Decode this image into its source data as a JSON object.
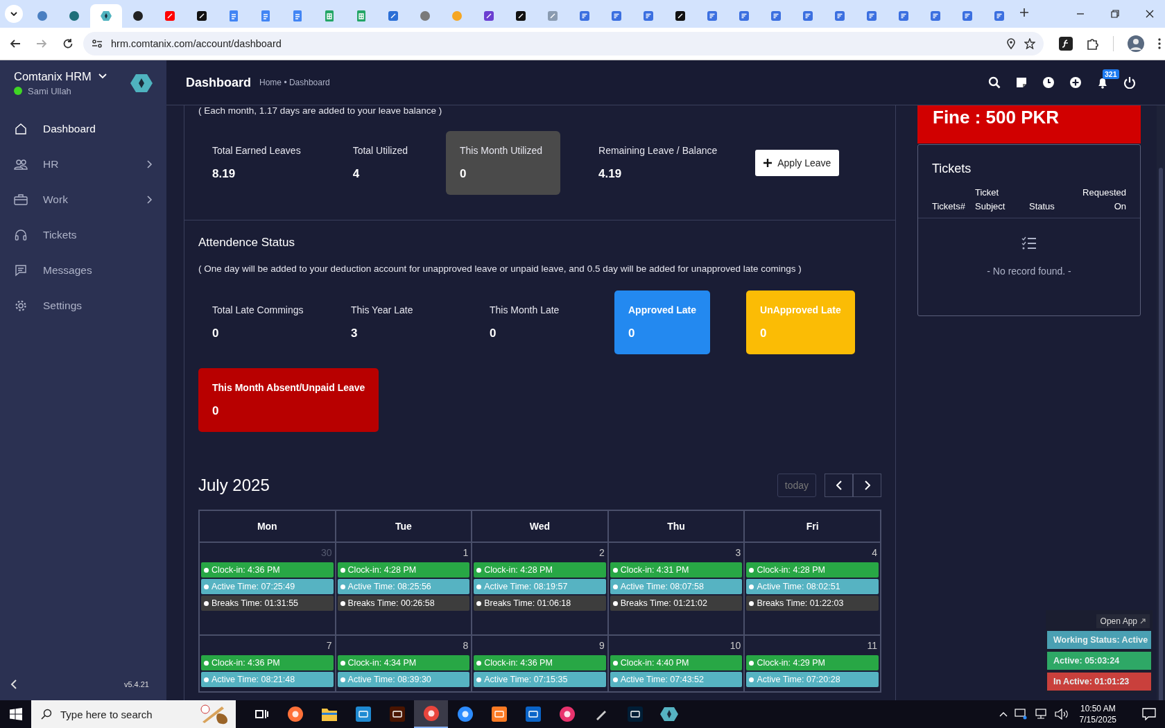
{
  "browser": {
    "tabs": [
      {
        "kind": "circle",
        "color": "#4a7fc1",
        "selected": false
      },
      {
        "kind": "circle",
        "color": "#1e6f7a",
        "selected": false
      },
      {
        "kind": "hex",
        "color": "#4fb3bf",
        "selected": true
      },
      {
        "kind": "circle",
        "color": "#222222",
        "selected": false
      },
      {
        "kind": "square",
        "color": "#ff0000",
        "selected": false
      },
      {
        "kind": "square",
        "color": "#111111",
        "selected": false
      },
      {
        "kind": "doc",
        "color": "#4285f4",
        "selected": false
      },
      {
        "kind": "doc",
        "color": "#4285f4",
        "selected": false
      },
      {
        "kind": "doc",
        "color": "#4285f4",
        "selected": false
      },
      {
        "kind": "sheet",
        "color": "#23a566",
        "selected": false
      },
      {
        "kind": "sheet",
        "color": "#23a566",
        "selected": false
      },
      {
        "kind": "square",
        "color": "#2b6fd6",
        "selected": false
      },
      {
        "kind": "circle",
        "color": "#7a7a7a",
        "selected": false
      },
      {
        "kind": "circle",
        "color": "#f5a623",
        "selected": false
      },
      {
        "kind": "square",
        "color": "#6b3fd1",
        "selected": false
      },
      {
        "kind": "square",
        "color": "#111111",
        "selected": false
      },
      {
        "kind": "square",
        "color": "#8a9bb0",
        "selected": false
      },
      {
        "kind": "form",
        "color": "#3b6fe0",
        "selected": false
      },
      {
        "kind": "form",
        "color": "#3b6fe0",
        "selected": false
      },
      {
        "kind": "form",
        "color": "#3b6fe0",
        "selected": false
      },
      {
        "kind": "square",
        "color": "#111111",
        "selected": false
      },
      {
        "kind": "form",
        "color": "#3b6fe0",
        "selected": false
      },
      {
        "kind": "form",
        "color": "#3b6fe0",
        "selected": false
      },
      {
        "kind": "form",
        "color": "#3b6fe0",
        "selected": false
      },
      {
        "kind": "form",
        "color": "#3b6fe0",
        "selected": false
      },
      {
        "kind": "form",
        "color": "#3b6fe0",
        "selected": false
      },
      {
        "kind": "form",
        "color": "#3b6fe0",
        "selected": false
      },
      {
        "kind": "form",
        "color": "#3b6fe0",
        "selected": false
      },
      {
        "kind": "form",
        "color": "#3b6fe0",
        "selected": false
      },
      {
        "kind": "form",
        "color": "#3b6fe0",
        "selected": false
      },
      {
        "kind": "form",
        "color": "#3b6fe0",
        "selected": false
      }
    ],
    "url": "hrm.comtanix.com/account/dashboard"
  },
  "sidebar": {
    "brand": "Comtanix HRM",
    "user": {
      "name": "Sami Ullah",
      "online": true
    },
    "items": [
      {
        "label": "Dashboard",
        "kind": "home",
        "selected": true,
        "expandable": false
      },
      {
        "label": "HR",
        "kind": "people",
        "selected": false,
        "expandable": true
      },
      {
        "label": "Work",
        "kind": "briefcase",
        "selected": false,
        "expandable": true
      },
      {
        "label": "Tickets",
        "kind": "headset",
        "selected": false,
        "expandable": false
      },
      {
        "label": "Messages",
        "kind": "chat",
        "selected": false,
        "expandable": false
      },
      {
        "label": "Settings",
        "kind": "gear",
        "selected": false,
        "expandable": false
      }
    ],
    "version": "v5.4.21"
  },
  "header": {
    "title": "Dashboard",
    "breadcrumb": "Home • Dashboard",
    "notification_count": "321"
  },
  "leave": {
    "note": "( Each month, 1.17 days are added to your leave balance )",
    "stats": [
      {
        "label": "Total Earned Leaves",
        "value": "8.19",
        "highlighted": false
      },
      {
        "label": "Total Utilized",
        "value": "4",
        "highlighted": false
      },
      {
        "label": "This Month Utilized",
        "value": "0",
        "highlighted": true
      },
      {
        "label": "Remaining Leave / Balance",
        "value": "4.19",
        "highlighted": false
      }
    ],
    "apply_button": "Apply Leave"
  },
  "attendance": {
    "title": "Attendence Status",
    "note": "( One day will be added to your deduction account for unapproved leave or unpaid leave, and 0.5 day will be added for unapproved late comings )",
    "stats": [
      {
        "label": "Total Late Commings",
        "value": "0"
      },
      {
        "label": "This Year Late",
        "value": "3"
      },
      {
        "label": "This Month Late",
        "value": "0"
      },
      {
        "label": "Approved Late",
        "value": "0",
        "color": "#2389f0"
      },
      {
        "label": "UnApproved Late",
        "value": "0",
        "color": "#fbbc05"
      },
      {
        "label": "This Month Absent/Unpaid Leave",
        "value": "0",
        "color": "#b80000"
      }
    ]
  },
  "calendar": {
    "title": "July 2025",
    "today": {
      "label": "today",
      "disabled": true
    },
    "days": [
      "Mon",
      "Tue",
      "Wed",
      "Thu",
      "Fri"
    ],
    "weeks": [
      [
        {
          "date": "30",
          "other_month": true,
          "events": [
            {
              "kind": "clock-in",
              "text": "Clock-in: 4:36 PM"
            },
            {
              "kind": "active",
              "text": "Active Time: 07:25:49"
            },
            {
              "kind": "breaks",
              "text": "Breaks Time: 01:31:55"
            }
          ]
        },
        {
          "date": "1",
          "other_month": false,
          "events": [
            {
              "kind": "clock-in",
              "text": "Clock-in: 4:28 PM"
            },
            {
              "kind": "active",
              "text": "Active Time: 08:25:56"
            },
            {
              "kind": "breaks",
              "text": "Breaks Time: 00:26:58"
            }
          ]
        },
        {
          "date": "2",
          "other_month": false,
          "events": [
            {
              "kind": "clock-in",
              "text": "Clock-in: 4:28 PM"
            },
            {
              "kind": "active",
              "text": "Active Time: 08:19:57"
            },
            {
              "kind": "breaks",
              "text": "Breaks Time: 01:06:18"
            }
          ]
        },
        {
          "date": "3",
          "other_month": false,
          "events": [
            {
              "kind": "clock-in",
              "text": "Clock-in: 4:31 PM"
            },
            {
              "kind": "active",
              "text": "Active Time: 08:07:58"
            },
            {
              "kind": "breaks",
              "text": "Breaks Time: 01:21:02"
            }
          ]
        },
        {
          "date": "4",
          "other_month": false,
          "events": [
            {
              "kind": "clock-in",
              "text": "Clock-in: 4:28 PM"
            },
            {
              "kind": "active",
              "text": "Active Time: 08:02:51"
            },
            {
              "kind": "breaks",
              "text": "Breaks Time: 01:22:03"
            }
          ]
        }
      ],
      [
        {
          "date": "7",
          "other_month": false,
          "events": [
            {
              "kind": "clock-in",
              "text": "Clock-in: 4:36 PM"
            },
            {
              "kind": "active",
              "text": "Active Time: 08:21:48"
            }
          ]
        },
        {
          "date": "8",
          "other_month": false,
          "events": [
            {
              "kind": "clock-in",
              "text": "Clock-in: 4:34 PM"
            },
            {
              "kind": "active",
              "text": "Active Time: 08:39:30"
            }
          ]
        },
        {
          "date": "9",
          "other_month": false,
          "events": [
            {
              "kind": "clock-in",
              "text": "Clock-in: 4:36 PM"
            },
            {
              "kind": "active",
              "text": "Active Time: 07:15:35"
            }
          ]
        },
        {
          "date": "10",
          "other_month": false,
          "events": [
            {
              "kind": "clock-in",
              "text": "Clock-in: 4:40 PM"
            },
            {
              "kind": "active",
              "text": "Active Time: 07:43:52"
            }
          ]
        },
        {
          "date": "11",
          "other_month": false,
          "events": [
            {
              "kind": "clock-in",
              "text": "Clock-in: 4:29 PM"
            },
            {
              "kind": "active",
              "text": "Active Time: 07:20:28"
            }
          ]
        }
      ]
    ]
  },
  "fine": "Fine : 500 PKR",
  "tickets": {
    "title": "Tickets",
    "columns": [
      "Tickets#",
      "Ticket Subject",
      "Status",
      "Requested On"
    ],
    "empty_text": "- No record found. -"
  },
  "widget": {
    "open_app": "Open App",
    "rows": [
      {
        "text": "Working Status: Active",
        "color": "#4aa0b3"
      },
      {
        "text": "Active: 05:03:24",
        "color": "#2ea866"
      },
      {
        "text": "In Active: 01:01:23",
        "color": "#c9403c"
      }
    ]
  },
  "taskbar": {
    "search_placeholder": "Type here to search",
    "apps": [
      {
        "kind": "taskview",
        "color": "#ffffff",
        "selected": false
      },
      {
        "kind": "circle",
        "color": "#ff7139",
        "selected": false
      },
      {
        "kind": "folder",
        "color": "#f6c342",
        "selected": false
      },
      {
        "kind": "square",
        "color": "#1f8ad2",
        "selected": false
      },
      {
        "kind": "square",
        "color": "#4a1500",
        "selected": false
      },
      {
        "kind": "circle",
        "color": "#e8453c",
        "selected": true
      },
      {
        "kind": "circle",
        "color": "#2d8cff",
        "selected": false
      },
      {
        "kind": "square",
        "color": "#fb7a24",
        "selected": false
      },
      {
        "kind": "square",
        "color": "#0a64c8",
        "selected": false
      },
      {
        "kind": "circle",
        "color": "#e8336d",
        "selected": false
      },
      {
        "kind": "pen",
        "color": "#cccccc",
        "selected": false
      },
      {
        "kind": "square",
        "color": "#001e36",
        "selected": false
      },
      {
        "kind": "hex",
        "color": "#56b3c2",
        "selected": false
      }
    ],
    "time": "10:50 AM",
    "date": "7/15/2025"
  }
}
